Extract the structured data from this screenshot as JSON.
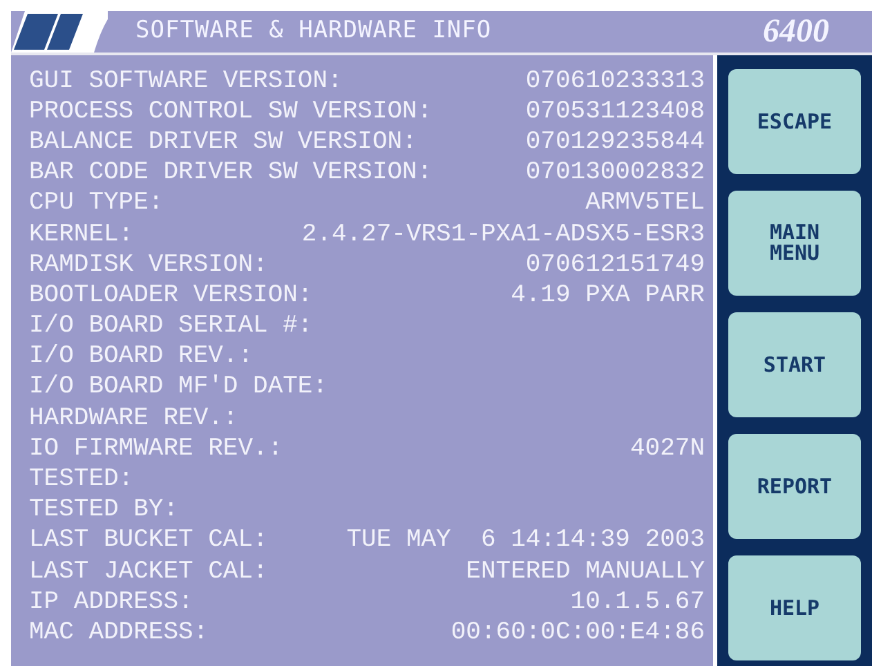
{
  "header": {
    "title": "SOFTWARE & HARDWARE INFO",
    "model": "6400"
  },
  "info_rows": [
    {
      "label": "GUI SOFTWARE VERSION:",
      "value": "070610233313"
    },
    {
      "label": "PROCESS CONTROL SW VERSION:",
      "value": "070531123408"
    },
    {
      "label": "BALANCE DRIVER SW VERSION:",
      "value": "070129235844"
    },
    {
      "label": "BAR CODE DRIVER SW VERSION:",
      "value": "070130002832"
    },
    {
      "label": "CPU TYPE:",
      "value": "ARMV5TEL"
    },
    {
      "label": "KERNEL:",
      "value": "2.4.27-VRS1-PXA1-ADSX5-ESR3"
    },
    {
      "label": "RAMDISK VERSION:",
      "value": "070612151749"
    },
    {
      "label": "BOOTLOADER VERSION:",
      "value": "4.19 PXA PARR"
    },
    {
      "label": "I/O BOARD SERIAL #:"
    },
    {
      "label": "I/O BOARD REV.:"
    },
    {
      "label": "I/O BOARD MF'D DATE:"
    },
    {
      "label": "HARDWARE REV.:"
    },
    {
      "label": "IO FIRMWARE REV.:",
      "value": "4027N"
    },
    {
      "label": "TESTED:"
    },
    {
      "label": "TESTED BY:"
    },
    {
      "label": "LAST BUCKET CAL:",
      "value": "TUE MAY  6 14:14:39 2003"
    },
    {
      "label": "LAST JACKET CAL:",
      "value": "ENTERED MANUALLY"
    },
    {
      "label": "IP ADDRESS:",
      "value": "10.1.5.67"
    },
    {
      "label": "MAC ADDRESS:",
      "value": "00:60:0C:00:E4:86"
    }
  ],
  "buttons": [
    {
      "label": "ESCAPE"
    },
    {
      "label": "MAIN MENU"
    },
    {
      "label": "START"
    },
    {
      "label": "REPORT"
    },
    {
      "label": "HELP"
    }
  ]
}
